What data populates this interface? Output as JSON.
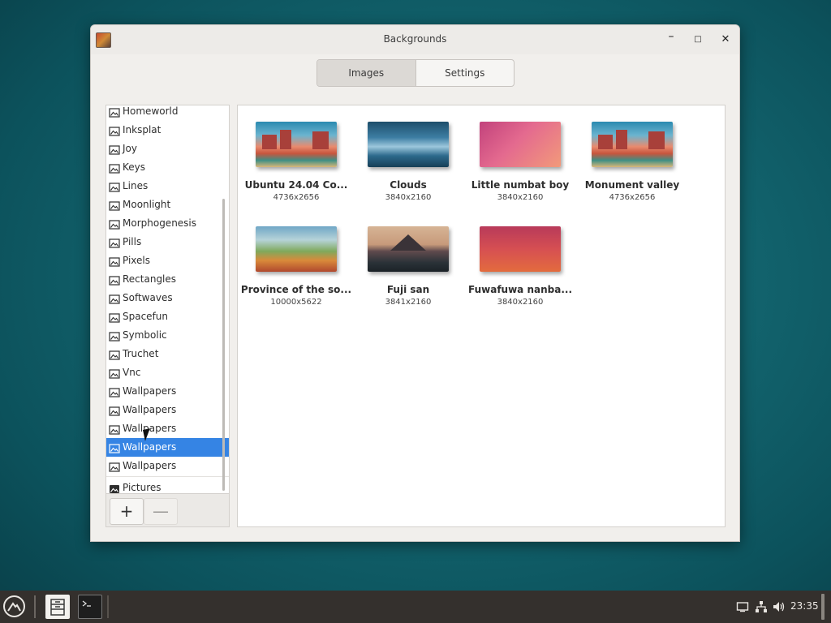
{
  "window": {
    "title": "Backgrounds",
    "controls": {
      "minimize": "–",
      "maximize": "□",
      "close": "✕"
    },
    "icon": "backgrounds-app-icon"
  },
  "tabs": [
    {
      "label": "Images",
      "active": true
    },
    {
      "label": "Settings",
      "active": false
    }
  ],
  "sidebar": {
    "items": [
      {
        "label": "Homeworld",
        "icon": "image-folder-icon"
      },
      {
        "label": "Inksplat",
        "icon": "image-folder-icon"
      },
      {
        "label": "Joy",
        "icon": "image-folder-icon"
      },
      {
        "label": "Keys",
        "icon": "image-folder-icon"
      },
      {
        "label": "Lines",
        "icon": "image-folder-icon"
      },
      {
        "label": "Moonlight",
        "icon": "image-folder-icon"
      },
      {
        "label": "Morphogenesis",
        "icon": "image-folder-icon"
      },
      {
        "label": "Pills",
        "icon": "image-folder-icon"
      },
      {
        "label": "Pixels",
        "icon": "image-folder-icon"
      },
      {
        "label": "Rectangles",
        "icon": "image-folder-icon"
      },
      {
        "label": "Softwaves",
        "icon": "image-folder-icon"
      },
      {
        "label": "Spacefun",
        "icon": "image-folder-icon"
      },
      {
        "label": "Symbolic",
        "icon": "image-folder-icon"
      },
      {
        "label": "Truchet",
        "icon": "image-folder-icon"
      },
      {
        "label": "Vnc",
        "icon": "image-folder-icon"
      },
      {
        "label": "Wallpapers",
        "icon": "image-folder-icon"
      },
      {
        "label": "Wallpapers",
        "icon": "image-folder-icon"
      },
      {
        "label": "Wallpapers",
        "icon": "image-folder-icon"
      },
      {
        "label": "Wallpapers",
        "icon": "image-folder-icon",
        "selected": true
      },
      {
        "label": "Wallpapers",
        "icon": "image-folder-icon"
      },
      {
        "label": "Pictures",
        "icon": "pictures-folder-icon"
      }
    ],
    "add_label": "+",
    "remove_label": "—"
  },
  "images": [
    {
      "name": "Ubuntu 24.04 Co...",
      "size": "4736x2656",
      "style": "monument"
    },
    {
      "name": "Clouds",
      "size": "3840x2160",
      "style": "clouds"
    },
    {
      "name": "Little numbat boy",
      "size": "3840x2160",
      "style": "numbat"
    },
    {
      "name": "Monument valley",
      "size": "4736x2656",
      "style": "monument"
    },
    {
      "name": "Province of the so...",
      "size": "10000x5622",
      "style": "province"
    },
    {
      "name": "Fuji san",
      "size": "3841x2160",
      "style": "fuji"
    },
    {
      "name": "Fuwafuwa nanba...",
      "size": "3840x2160",
      "style": "fuwa"
    }
  ],
  "taskbar": {
    "start_icon": "budgie-menu-icon",
    "apps": [
      "file-manager-icon",
      "terminal-icon"
    ],
    "tray": [
      "display-icon",
      "network-icon",
      "volume-icon"
    ],
    "clock": "23:35"
  },
  "colors": {
    "selection": "#3584e4",
    "desktop": "#136670",
    "panel": "#34302d"
  }
}
